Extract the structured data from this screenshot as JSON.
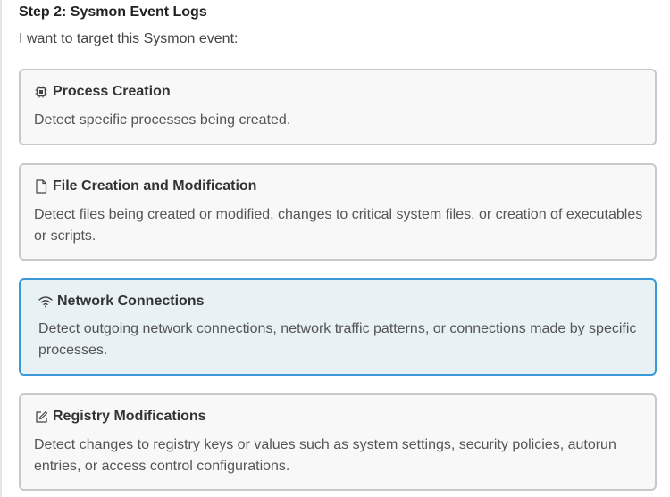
{
  "step": {
    "title": "Step 2: Sysmon Event Logs",
    "prompt": "I want to target this Sysmon event:"
  },
  "options": [
    {
      "icon": "cpu-icon",
      "title": "Process Creation",
      "description": "Detect specific processes being created.",
      "selected": false
    },
    {
      "icon": "file-icon",
      "title": "File Creation and Modification",
      "description": "Detect files being created or modified, changes to critical system files, or creation of executables or scripts.",
      "selected": false
    },
    {
      "icon": "wifi-icon",
      "title": "Network Connections",
      "description": "Detect outgoing network connections, network traffic patterns, or connections made by specific processes.",
      "selected": true
    },
    {
      "icon": "edit-icon",
      "title": "Registry Modifications",
      "description": "Detect changes to registry keys or values such as system settings, security policies, autorun entries, or access control configurations.",
      "selected": false
    }
  ],
  "colors": {
    "selected_border": "#3a9ad9",
    "selected_background": "#e8f1f3",
    "card_border": "#c8c8c8",
    "card_background": "#f8f8f8"
  }
}
